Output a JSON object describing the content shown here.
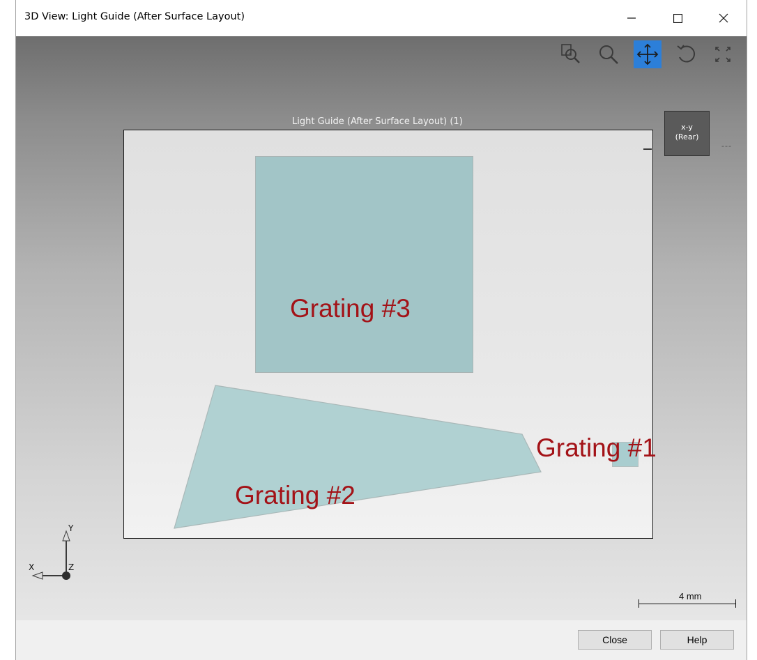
{
  "window": {
    "title": "3D View: Light Guide (After Surface Layout)",
    "controls": {
      "minimize_icon": "minimize-icon",
      "maximize_icon": "maximize-icon",
      "close_icon": "close-icon"
    }
  },
  "toolbar": {
    "tools": [
      {
        "name": "zoom-window",
        "icon": "zoom-window-icon",
        "active": false
      },
      {
        "name": "zoom",
        "icon": "magnifier-icon",
        "active": false
      },
      {
        "name": "pan",
        "icon": "move-arrows-icon",
        "active": true
      },
      {
        "name": "rotate",
        "icon": "rotate-icon",
        "active": false
      },
      {
        "name": "fit-all",
        "icon": "expand-corners-icon",
        "active": false
      }
    ],
    "active_color": "#2c7fd9"
  },
  "viewport": {
    "layout_label": "Light Guide (After Surface Layout) (1)",
    "view_cube": {
      "line1": "x-y",
      "line2": "(Rear)",
      "extra_marker": "---"
    },
    "surface_color": "#a2c5c7",
    "annotation_color": "#a31217",
    "annotations": {
      "grating3": "Grating #3",
      "grating2": "Grating #2",
      "grating1": "Grating #1"
    },
    "axes": {
      "y": "Y",
      "x": "X",
      "z": "Z"
    },
    "scale_bar": {
      "label": "4 mm"
    }
  },
  "footer": {
    "close_label": "Close",
    "help_label": "Help"
  }
}
